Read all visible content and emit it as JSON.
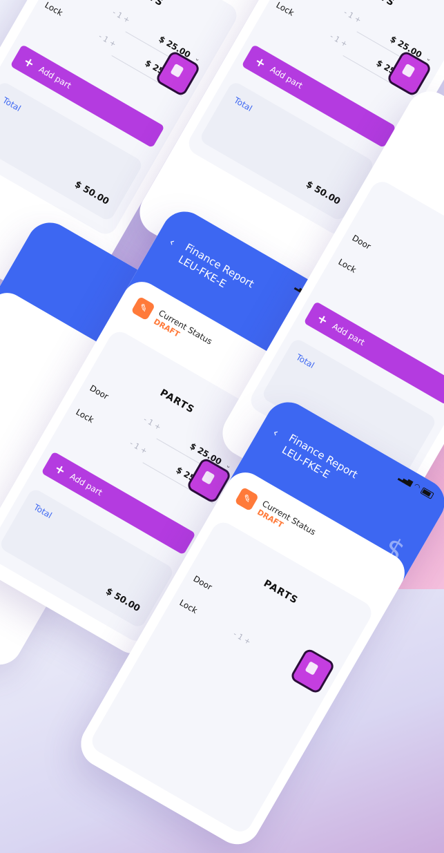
{
  "header": {
    "back_icon": "‹",
    "title_line1": "Finance Report",
    "title_line2": "LEU-FKE-E",
    "dollar_icon": "$"
  },
  "status": {
    "label": "Current Status",
    "value": "DRAFT",
    "doc_icon": "✎"
  },
  "status_bar": {
    "signal": "▂▄▆",
    "wifi": "◠"
  },
  "parts": {
    "title": "PARTS",
    "rows": [
      {
        "name": "Door",
        "qty": "- 1 +",
        "price": "$ 25.00",
        "chev": "⌄"
      },
      {
        "name": "Lock",
        "qty": "- 1 +",
        "price": "$ 25.00",
        "chev": "⌄"
      }
    ],
    "add_label": "Add part",
    "add_icon": "+",
    "total_label": "Total",
    "total_value": "$ 50.00"
  },
  "colors": {
    "primary": "#3d67f2",
    "accent": "#b43be0",
    "draft": "#ff7a3a"
  }
}
